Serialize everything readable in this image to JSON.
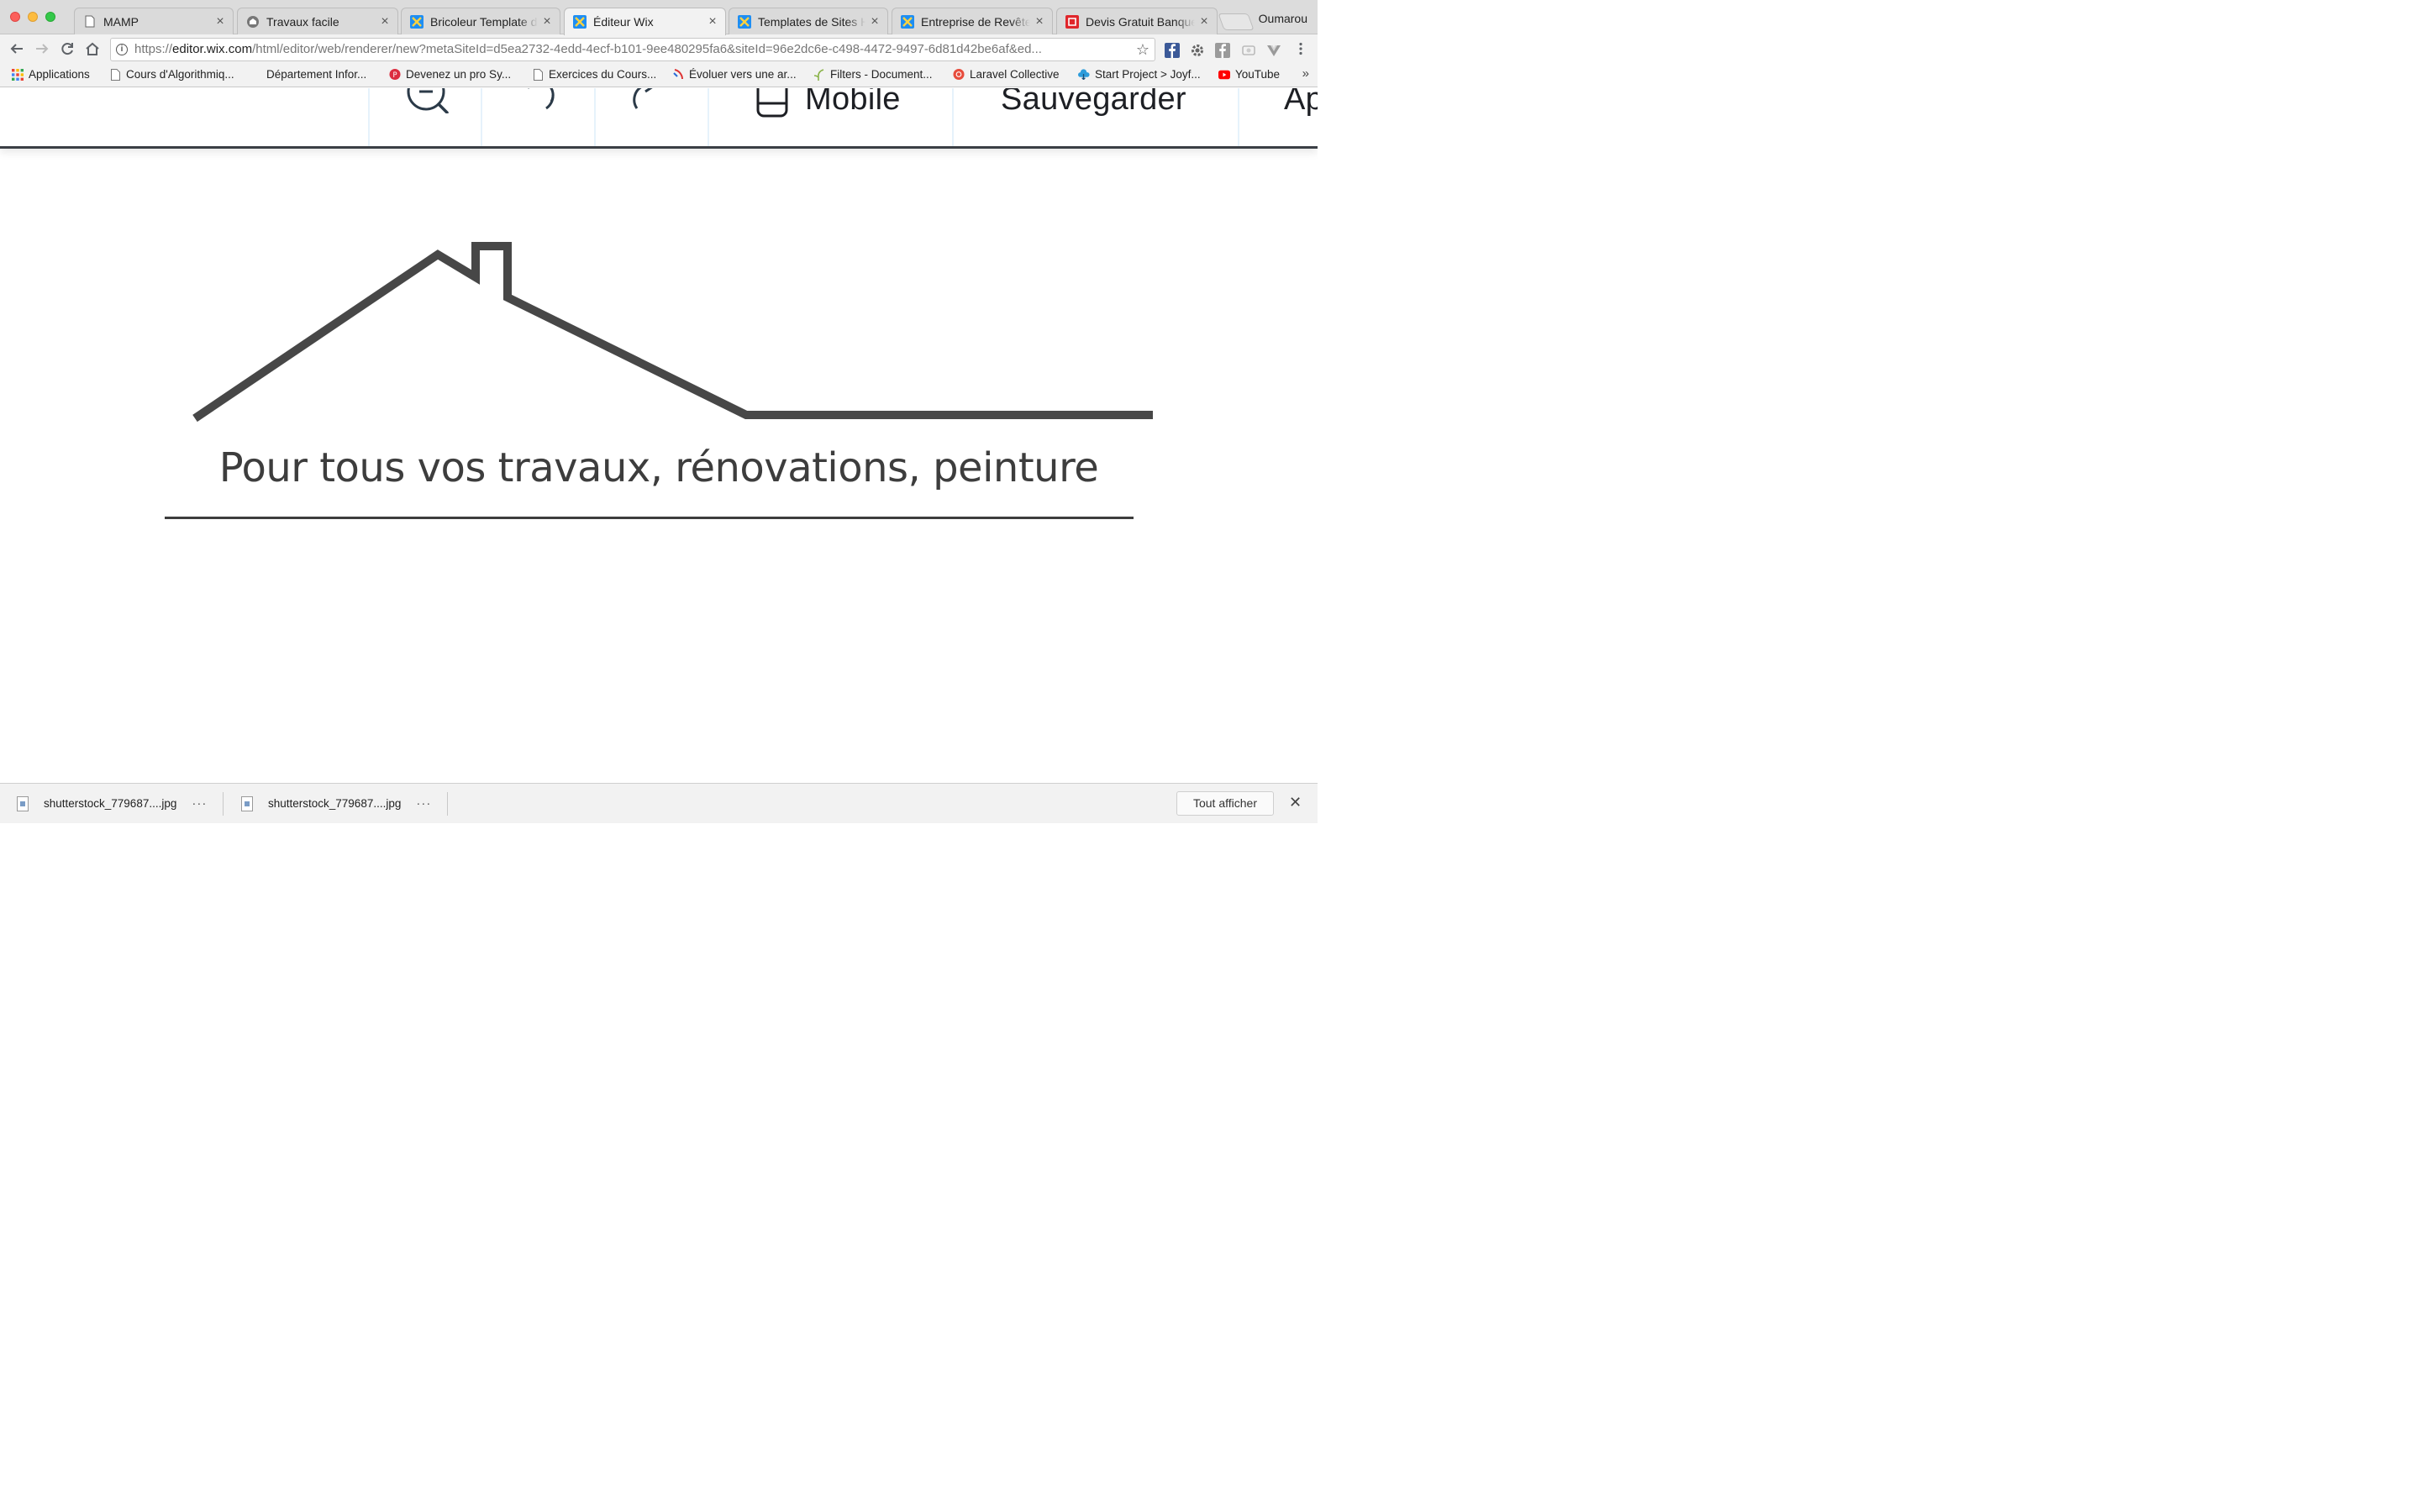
{
  "browser": {
    "profile_name": "Oumarou",
    "tabs": [
      {
        "title": "MAMP",
        "icon": "page-icon",
        "active": false
      },
      {
        "title": "Travaux facile",
        "icon": "site-icon",
        "active": false
      },
      {
        "title": "Bricoleur Template de",
        "icon": "wix-icon",
        "active": false
      },
      {
        "title": "Éditeur Wix",
        "icon": "wix-icon",
        "active": true
      },
      {
        "title": "Templates de Sites HT",
        "icon": "wix-icon",
        "active": false
      },
      {
        "title": "Entreprise de Revêtem",
        "icon": "wix-icon",
        "active": false
      },
      {
        "title": "Devis Gratuit Banque",
        "icon": "red-icon",
        "active": false
      }
    ],
    "address": {
      "scheme": "https://",
      "host": "editor.wix.com",
      "path": "/html/editor/web/renderer/new?metaSiteId=d5ea2732-4edd-4ecf-b101-9ee480295fa6&siteId=96e2dc6e-c498-4472-9497-6d81d42be6af&ed..."
    },
    "bookmarks": [
      {
        "label": "Applications",
        "icon": "apps-grid-icon"
      },
      {
        "label": "Cours d'Algorithmiq...",
        "icon": "page-icon"
      },
      {
        "label": "Département Infor...",
        "icon": "none"
      },
      {
        "label": "Devenez un pro Sy...",
        "icon": "red-circle-icon"
      },
      {
        "label": "Exercices du Cours...",
        "icon": "page-icon"
      },
      {
        "label": "Évoluer vers une ar...",
        "icon": "rocket-icon"
      },
      {
        "label": "Filters - Document...",
        "icon": "plant-icon"
      },
      {
        "label": "Laravel Collective",
        "icon": "red-circle-icon"
      },
      {
        "label": "Start Project > Joyf...",
        "icon": "cloud-icon"
      },
      {
        "label": "YouTube",
        "icon": "youtube-icon"
      }
    ],
    "more_bookmarks": "»"
  },
  "editor_toolbar": {
    "mobile_label": "Mobile",
    "save_label": "Sauvegarder",
    "preview_label_partial": "Ap"
  },
  "page": {
    "tagline": "Pour tous vos travaux, rénovations, peinture"
  },
  "downloads": {
    "items": [
      {
        "filename": "shutterstock_779687....jpg"
      },
      {
        "filename": "shutterstock_779687....jpg"
      }
    ],
    "show_all_label": "Tout afficher",
    "more": "···",
    "close": "✕"
  },
  "colors": {
    "house_stroke": "#474747",
    "text_dark": "#3d3d3d",
    "wix_blue": "#1e8ef3"
  }
}
